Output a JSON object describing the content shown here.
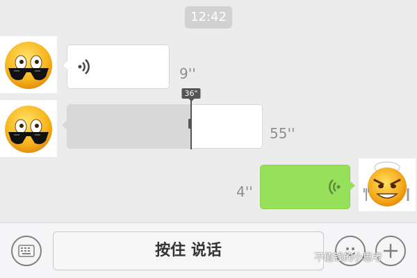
{
  "chat": {
    "timestamp": "12:42",
    "messages": [
      {
        "side": "left",
        "avatar": "sunglasses-emoji-avatar",
        "type": "voice",
        "duration": "9''"
      },
      {
        "side": "left",
        "avatar": "sunglasses-emoji-avatar",
        "type": "voice",
        "duration": "55''",
        "playback_position": "36\"",
        "progress_fraction": 0.63
      },
      {
        "side": "right",
        "avatar": "chef-emoji-avatar",
        "type": "voice",
        "duration": "4''"
      }
    ]
  },
  "input_bar": {
    "keyboard_icon": "keyboard-icon",
    "hold_to_talk_label": "按住 说话",
    "emoji_icon": "emoji-icon",
    "plus_icon": "plus-icon"
  },
  "watermark": {
    "text": "不值钱的小思考"
  },
  "colors": {
    "background": "#ececec",
    "bubble_incoming": "#ffffff",
    "bubble_outgoing": "#97e05a",
    "played_portion": "#d8d8d8"
  }
}
